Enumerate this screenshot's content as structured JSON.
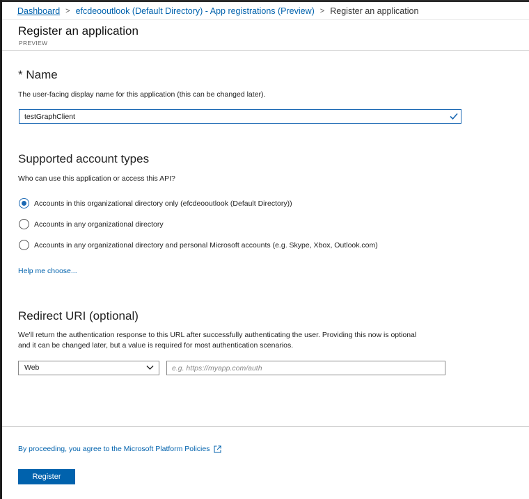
{
  "breadcrumb": {
    "items": [
      "Dashboard",
      "efcdeooutlook (Default Directory) - App registrations (Preview)",
      "Register an application"
    ],
    "separator": ">"
  },
  "page": {
    "title": "Register an application",
    "subtitle": "PREVIEW"
  },
  "name_section": {
    "required_marker": "*",
    "heading": "Name",
    "description": "The user-facing display name for this application (this can be changed later).",
    "value": "testGraphClient",
    "valid_icon": "check-icon"
  },
  "account_types": {
    "heading": "Supported account types",
    "question": "Who can use this application or access this API?",
    "options": [
      {
        "label": "Accounts in this organizational directory only (efcdeooutlook (Default Directory))",
        "selected": true
      },
      {
        "label": "Accounts in any organizational directory",
        "selected": false
      },
      {
        "label": "Accounts in any organizational directory and personal Microsoft accounts (e.g. Skype, Xbox, Outlook.com)",
        "selected": false
      }
    ],
    "help_link": "Help me choose..."
  },
  "redirect": {
    "heading": "Redirect URI (optional)",
    "description_line1": "We'll return the authentication response to this URL after successfully authenticating the user. Providing this now is optional",
    "description_line2": "and it can be changed later, but a value is required for most authentication scenarios.",
    "platform_selected": "Web",
    "uri_placeholder": "e.g. https://myapp.com/auth"
  },
  "footer": {
    "policy_text": "By proceeding, you agree to the Microsoft Platform Policies",
    "policy_icon": "external-link-icon",
    "register_label": "Register"
  },
  "colors": {
    "accent": "#0062ad",
    "radio_selected": "#1a68b3",
    "input_focus_border": "#1a68b3"
  }
}
